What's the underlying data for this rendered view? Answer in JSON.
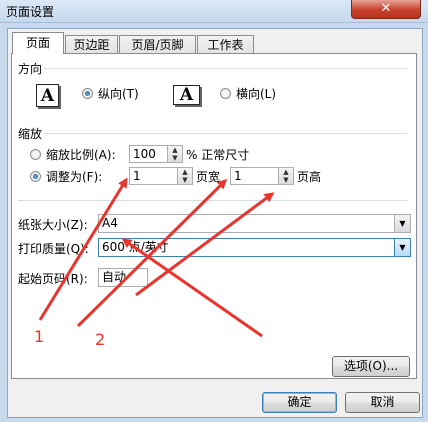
{
  "window": {
    "title": "页面设置",
    "close": "✕"
  },
  "tabs": [
    {
      "label": "页面"
    },
    {
      "label": "页边距"
    },
    {
      "label": "页眉/页脚"
    },
    {
      "label": "工作表"
    }
  ],
  "orientation": {
    "section_label": "方向",
    "icon_glyph": "A",
    "portrait_label": "纵向(T)",
    "landscape_label": "横向(L)",
    "selected": "portrait"
  },
  "scaling": {
    "section_label": "缩放",
    "adjust_label": "缩放比例(A):",
    "adjust_value": "100",
    "adjust_suffix": "% 正常尺寸",
    "fit_label": "调整为(F):",
    "fit_wide_value": "1",
    "fit_wide_suffix": "页宽",
    "fit_tall_value": "1",
    "fit_tall_suffix": "页高",
    "selected": "fit"
  },
  "paper": {
    "size_label": "纸张大小(Z):",
    "size_value": "A4",
    "quality_label": "打印质量(Q):",
    "quality_value": "600 点/英寸",
    "first_page_label": "起始页码(R):",
    "first_page_value": "自动"
  },
  "options_button": "选项(O)...",
  "ok_button": "确定",
  "cancel_button": "取消",
  "annotations": {
    "arrow_color": "#e8362e",
    "label_1": "1",
    "label_2": "2"
  },
  "colors": {
    "frame": "#c9d9ec",
    "close": "#c7412c",
    "accent": "#3c7fb1"
  },
  "icons": {
    "spin_up": "▲",
    "spin_down": "▼",
    "dropdown": "▼"
  }
}
